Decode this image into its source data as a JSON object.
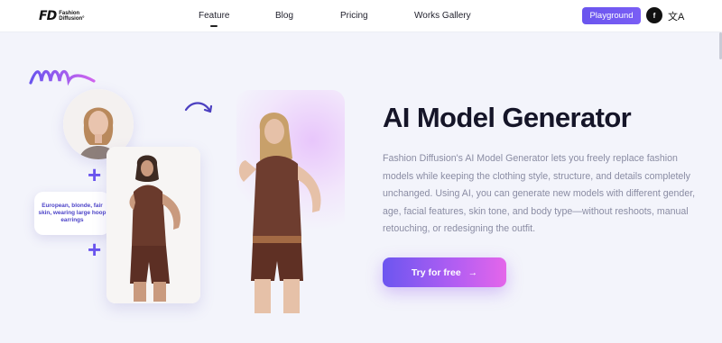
{
  "header": {
    "logo_mark": "FD",
    "logo_line1": "Fashion",
    "logo_line2": "Diffusion°",
    "nav": [
      {
        "label": "Feature",
        "active": true
      },
      {
        "label": "Blog",
        "active": false
      },
      {
        "label": "Pricing",
        "active": false
      },
      {
        "label": "Works Gallery",
        "active": false
      }
    ],
    "playground_label": "Playground",
    "social_label": "f",
    "language_glyph": "文A"
  },
  "hero": {
    "title": "AI Model Generator",
    "description": "Fashion Diffusion's AI Model Generator lets you freely replace fashion models while keeping the clothing style, structure, and details completely unchanged. Using AI, you can generate new models with different gender, age, facial features, skin tone, and body type—without reshoots, manual retouching, or redesigning the outfit.",
    "cta_label": "Try for free",
    "cta_arrow": "→",
    "prompt_text": "European, blonde, fair skin, wearing large hoop earrings",
    "plus_1": "+",
    "plus_2": "+"
  },
  "colors": {
    "accent": "#6a55ee",
    "cta_gradient_end": "#e466ea",
    "background": "#f3f4fb"
  }
}
